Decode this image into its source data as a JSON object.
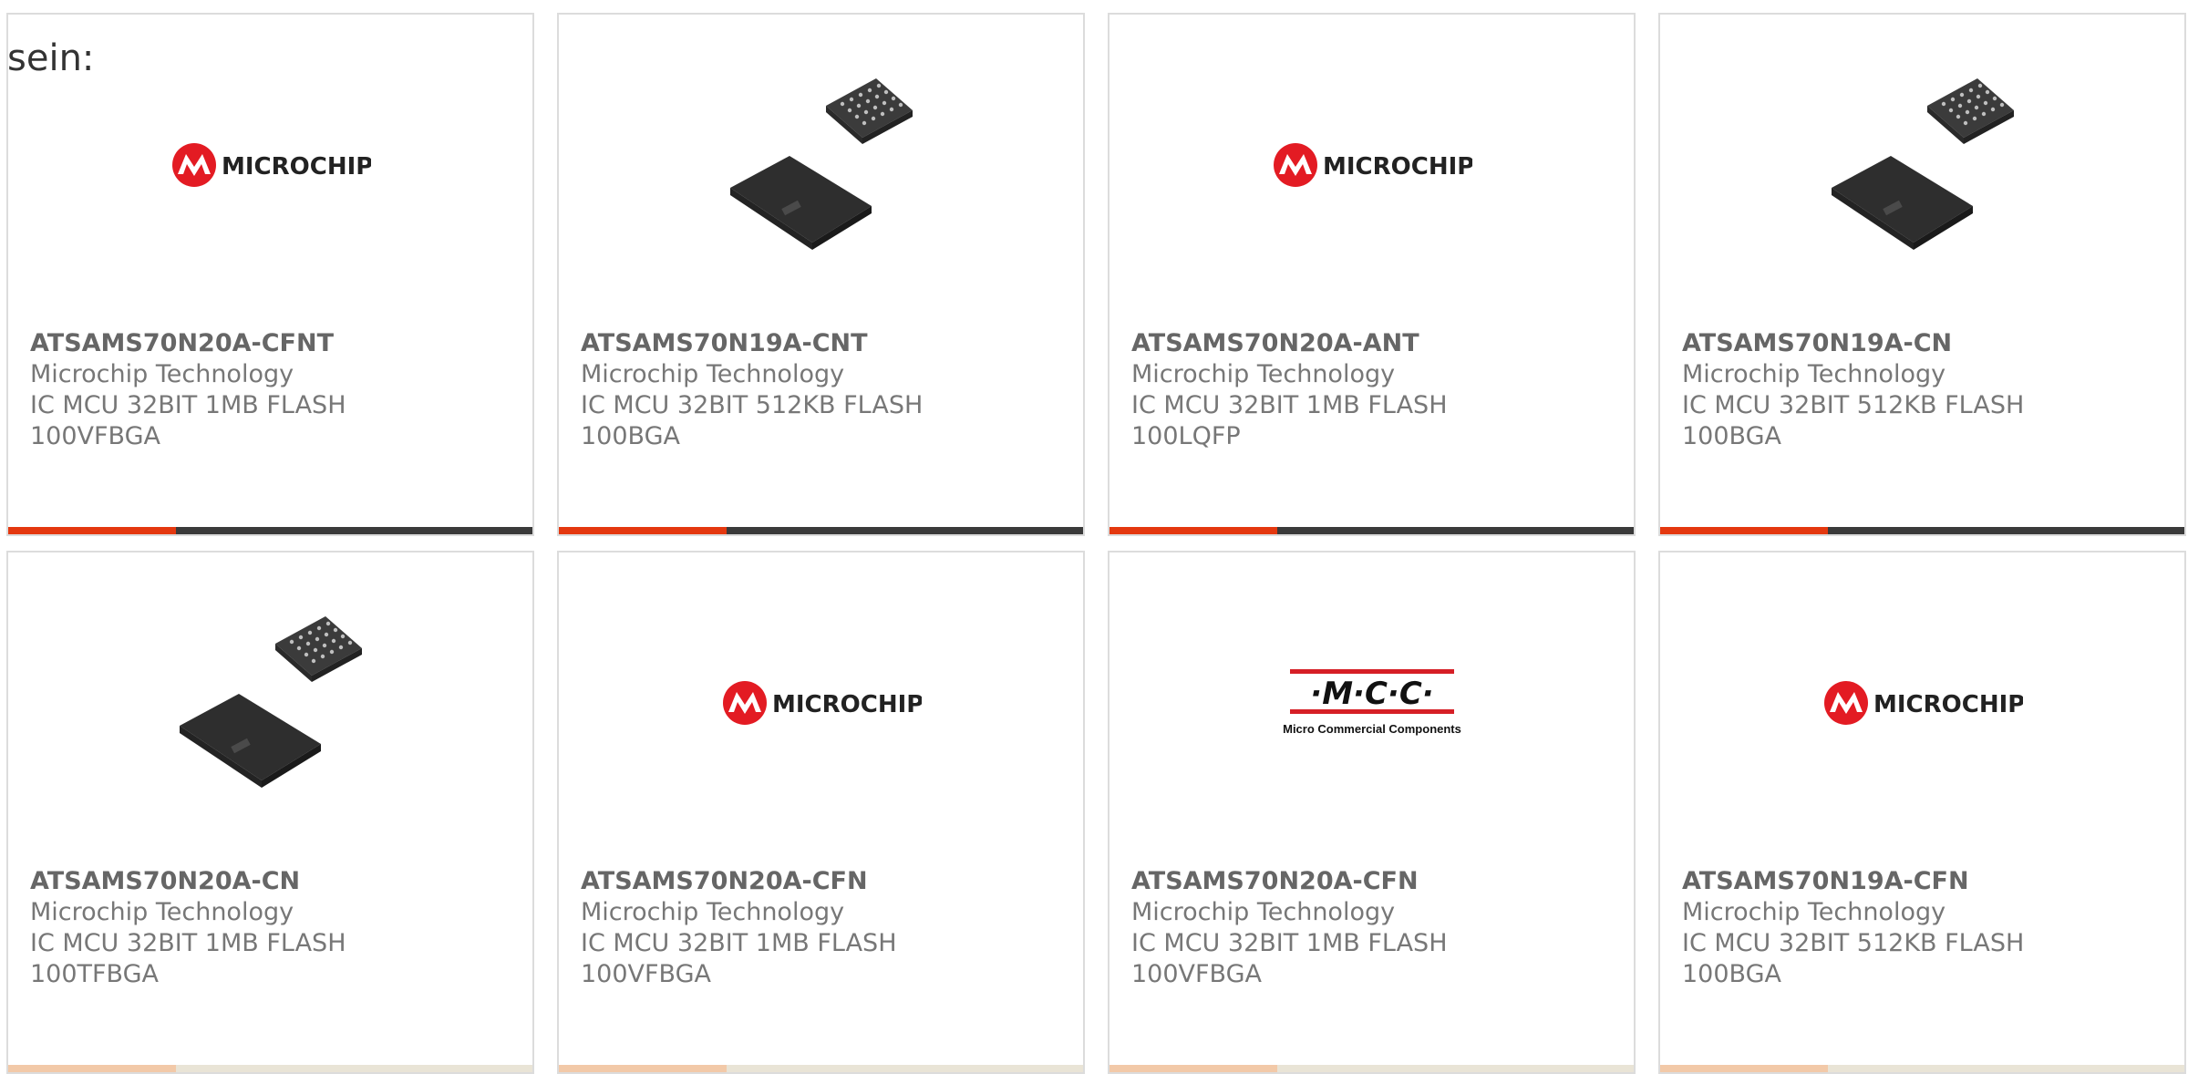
{
  "intro_text": "sein:",
  "colors": {
    "accent": "#e4380f",
    "bar_dark": "#3a3a3a",
    "microchip_red": "#e31b23",
    "mcc_red": "#d61f26"
  },
  "products": [
    {
      "part": "ATSAMS70N20A-CFNT",
      "manufacturer": "Microchip Technology",
      "desc1": "IC MCU 32BIT 1MB FLASH",
      "desc2": "100VFBGA",
      "image": "microchip-logo",
      "logo_text": "MICROCHIP"
    },
    {
      "part": "ATSAMS70N19A-CNT",
      "manufacturer": "Microchip Technology",
      "desc1": "IC MCU 32BIT 512KB FLASH",
      "desc2": "100BGA",
      "image": "bga-chip"
    },
    {
      "part": "ATSAMS70N20A-ANT",
      "manufacturer": "Microchip Technology",
      "desc1": "IC MCU 32BIT 1MB FLASH",
      "desc2": "100LQFP",
      "image": "microchip-logo",
      "logo_text": "MICROCHIP"
    },
    {
      "part": "ATSAMS70N19A-CN",
      "manufacturer": "Microchip Technology",
      "desc1": "IC MCU 32BIT 512KB FLASH",
      "desc2": "100BGA",
      "image": "bga-chip"
    },
    {
      "part": "ATSAMS70N20A-CN",
      "manufacturer": "Microchip Technology",
      "desc1": "IC MCU 32BIT 1MB FLASH",
      "desc2": "100TFBGA",
      "image": "bga-chip"
    },
    {
      "part": "ATSAMS70N20A-CFN",
      "manufacturer": "Microchip Technology",
      "desc1": "IC MCU 32BIT 1MB FLASH",
      "desc2": "100VFBGA",
      "image": "microchip-logo",
      "logo_text": "MICROCHIP"
    },
    {
      "part": "ATSAMS70N20A-CFN",
      "manufacturer": "Microchip Technology",
      "desc1": "IC MCU 32BIT 1MB FLASH",
      "desc2": "100VFBGA",
      "image": "mcc-logo",
      "logo_text": "·M·C·C·",
      "logo_subtext": "Micro Commercial Components"
    },
    {
      "part": "ATSAMS70N19A-CFN",
      "manufacturer": "Microchip Technology",
      "desc1": "IC MCU 32BIT 512KB FLASH",
      "desc2": "100BGA",
      "image": "microchip-logo",
      "logo_text": "MICROCHIP"
    }
  ]
}
